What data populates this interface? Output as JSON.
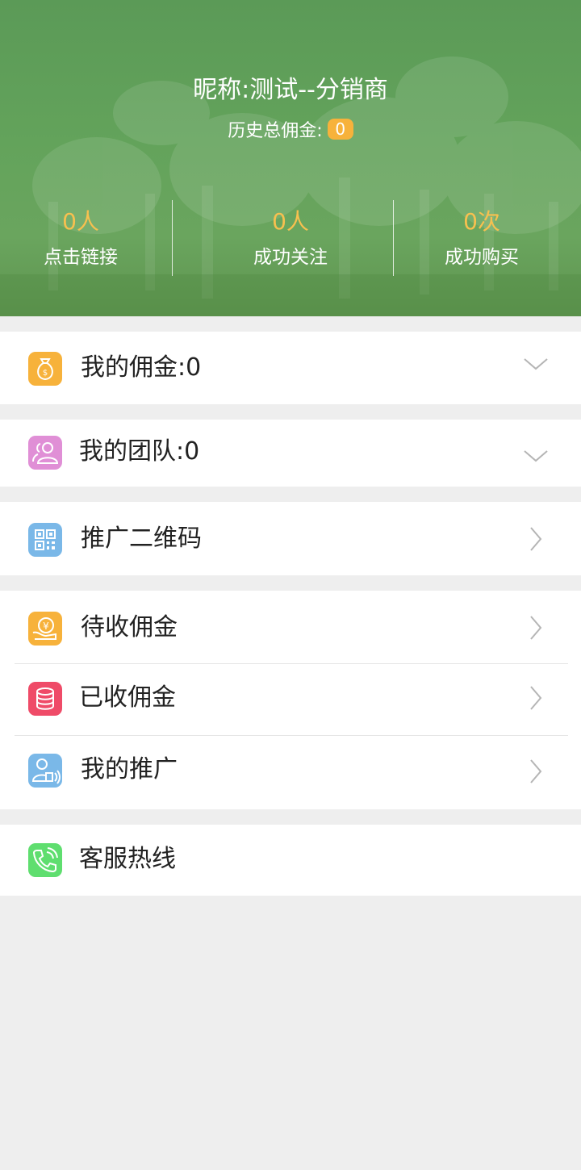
{
  "header": {
    "nickname": "昵称:测试--分销商",
    "history_label": "历史总佣金:",
    "history_value": "0",
    "stats": [
      {
        "value": "0人",
        "label": "点击链接"
      },
      {
        "value": "0人",
        "label": "成功关注"
      },
      {
        "value": "0次",
        "label": "成功购买"
      }
    ]
  },
  "menu": {
    "my_commission": {
      "label": "我的佣金:",
      "value": "0"
    },
    "my_team": {
      "label": "我的团队:",
      "value": "0"
    },
    "qr_code": {
      "label": "推广二维码"
    },
    "pending_commission": {
      "label": "待收佣金"
    },
    "received_commission": {
      "label": "已收佣金"
    },
    "my_promotion": {
      "label": "我的推广"
    },
    "service_hotline": {
      "label": "客服热线"
    }
  },
  "colors": {
    "header_green": "#63a35b",
    "accent_orange": "#f7b23b",
    "icon_pink": "#e08fd6",
    "icon_blue": "#7ab8e8",
    "icon_red": "#ef4b68",
    "icon_green": "#5fde6f",
    "background": "#eeeeee"
  },
  "icons": {
    "my_commission": "money-bag-icon",
    "my_team": "team-icon",
    "qr_code": "qr-code-icon",
    "pending_commission": "yuan-coin-hand-icon",
    "received_commission": "database-icon",
    "my_promotion": "person-speaker-icon",
    "service_hotline": "phone-icon"
  }
}
